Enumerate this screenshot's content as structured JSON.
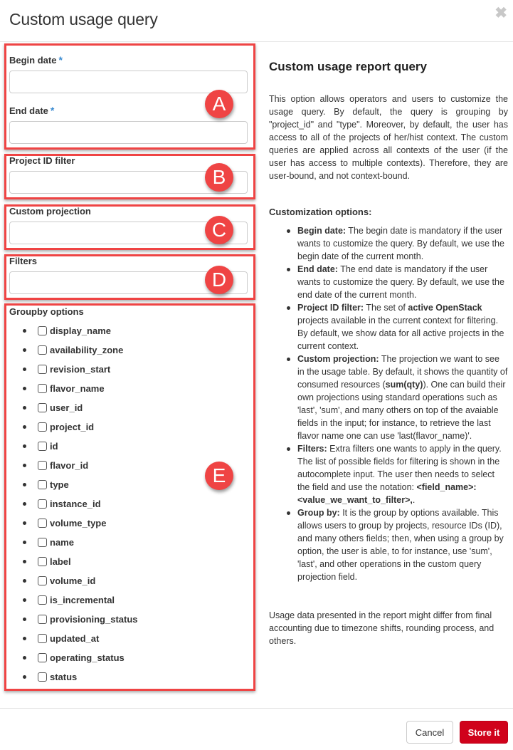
{
  "modal": {
    "title": "Custom usage query",
    "close_icon": "close-icon"
  },
  "form": {
    "begin_date": {
      "label": "Begin date",
      "required_mark": "*",
      "value": "",
      "placeholder": ""
    },
    "end_date": {
      "label": "End date",
      "required_mark": "*",
      "value": "",
      "placeholder": ""
    },
    "project_id_filter": {
      "label": "Project ID filter",
      "value": "",
      "placeholder": ""
    },
    "custom_projection": {
      "label": "Custom projection",
      "value": "",
      "placeholder": ""
    },
    "filters": {
      "label": "Filters",
      "value": "",
      "placeholder": ""
    },
    "groupby": {
      "label": "Groupby options",
      "options": [
        {
          "name": "display_name",
          "checked": false
        },
        {
          "name": "availability_zone",
          "checked": false
        },
        {
          "name": "revision_start",
          "checked": false
        },
        {
          "name": "flavor_name",
          "checked": false
        },
        {
          "name": "user_id",
          "checked": false
        },
        {
          "name": "project_id",
          "checked": false
        },
        {
          "name": "id",
          "checked": false
        },
        {
          "name": "flavor_id",
          "checked": false
        },
        {
          "name": "type",
          "checked": false
        },
        {
          "name": "instance_id",
          "checked": false
        },
        {
          "name": "volume_type",
          "checked": false
        },
        {
          "name": "name",
          "checked": false
        },
        {
          "name": "label",
          "checked": false
        },
        {
          "name": "volume_id",
          "checked": false
        },
        {
          "name": "is_incremental",
          "checked": false
        },
        {
          "name": "provisioning_status",
          "checked": false
        },
        {
          "name": "updated_at",
          "checked": false
        },
        {
          "name": "operating_status",
          "checked": false
        },
        {
          "name": "status",
          "checked": false
        }
      ]
    }
  },
  "annotations": {
    "a": "A",
    "b": "B",
    "c": "C",
    "d": "D",
    "e": "E",
    "color": "#ef4444"
  },
  "help": {
    "title": "Custom usage report query",
    "intro": "This option allows operators and users to customize the usage query. By default, the query is grouping by \"project_id\" and \"type\". Moreover, by default, the user has access to all of the projects of her/hist context. The custom queries are applied across all contexts of the user (if the user has access to multiple contexts). Therefore, they are user-bound, and not context-bound.",
    "subtitle": "Customization options:",
    "items": [
      {
        "term": "Begin date:",
        "text": " The begin date is mandatory if the user wants to customize the query. By default, we use the begin date of the current month."
      },
      {
        "term": "End date:",
        "text": " The end date is mandatory if the user wants to customize the query. By default, we use the end date of the current month."
      },
      {
        "term": "Project ID filter:",
        "text_before": " The set of ",
        "bold_inline": "active OpenStack",
        "text_after": " projects available in the current context for filtering. By default, we show data for all active projects in the current context."
      },
      {
        "term": "Custom projection:",
        "text_before": " The projection we want to see in the usage table. By default, it shows the quantity of consumed resources (",
        "bold_inline": "sum(qty)",
        "text_after": "). One can build their own projections using standard operations such as 'last', 'sum', and many others on top of the avaiable fields in the input; for instance, to retrieve the last flavor name one can use 'last(flavor_name)'."
      },
      {
        "term": "Filters:",
        "text_before": " Extra filters one wants to apply in the query. The list of possible fields for filtering is shown in the autocomplete input. The user then needs to select the field and use the notation: ",
        "bold_inline": "<field_name>:<value_we_want_to_filter>,",
        "text_after": "."
      },
      {
        "term": "Group by:",
        "text": " It is the group by options available. This allows users to group by projects, resource IDs (ID), and many others fields; then, when using a group by option, the user is able, to for instance, use 'sum', 'last', and other operations in the custom query projection field."
      }
    ],
    "footer": "Usage data presented in the report might differ from final accounting due to timezone shifts, rounding process, and others."
  },
  "footer": {
    "cancel_label": "Cancel",
    "store_label": "Store it",
    "store_color": "#d0021b"
  }
}
